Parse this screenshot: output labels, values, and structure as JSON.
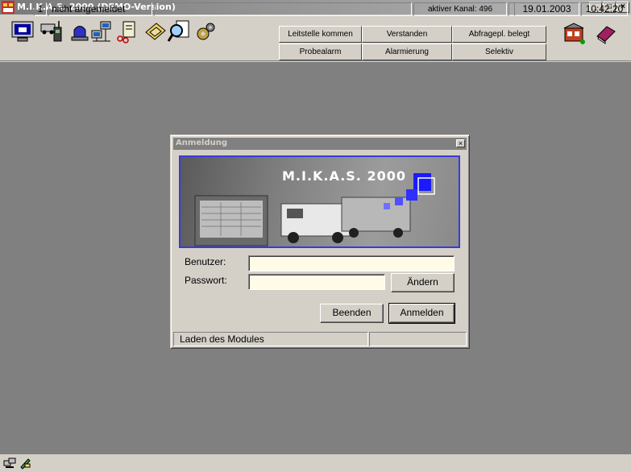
{
  "window": {
    "title": "M.I.K.A.S. 2000 (DEMO-Version)",
    "min": "_",
    "max": "□",
    "close": "×"
  },
  "toolbar": {
    "quick_buttons": [
      "Leitstelle kommen",
      "Verstanden",
      "Abfragepl. belegt",
      "Probealarm",
      "Alarmierung",
      "Selektiv"
    ]
  },
  "dialog": {
    "title": "Anmeldung",
    "close": "×",
    "banner_title": "M.I.K.A.S. 2000",
    "user_label": "Benutzer:",
    "password_label": "Passwort:",
    "user_value": "",
    "password_value": "",
    "change_button": "Ändern",
    "quit_button": "Beenden",
    "login_button": "Anmelden",
    "status_text": "Laden des Modules",
    "progress": 0
  },
  "statusbar": {
    "number": "1",
    "login_state": "nicht angemeldet",
    "channel": "aktiver Kanal: 496",
    "date": "19.01.2003",
    "time": "10:42:20"
  }
}
